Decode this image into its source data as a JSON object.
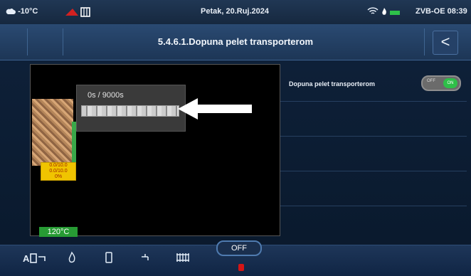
{
  "status_bar": {
    "outdoor_temp": "-10°C",
    "date": "Petak, 20.Ruj.2024",
    "device": "ZVB-OE",
    "time": "08:39"
  },
  "title_bar": {
    "title": "5.4.6.1.Dopuna pelet transporterom",
    "back_label": "<"
  },
  "diagram": {
    "feeder_timer": "0s / 9000s",
    "info_lines": [
      "0.0/10.0",
      "0.0/10.0",
      "0%"
    ],
    "boiler_temp": "120°C"
  },
  "settings": [
    {
      "label": "Dopuna pelet transporterom",
      "toggle_off": "OFF",
      "toggle_on": "ON"
    }
  ],
  "bottom_bar": {
    "mode_button": "OFF",
    "icons": [
      "boiler-icon",
      "flame-icon",
      "tank-icon",
      "tap-icon",
      "radiator-icon"
    ]
  }
}
